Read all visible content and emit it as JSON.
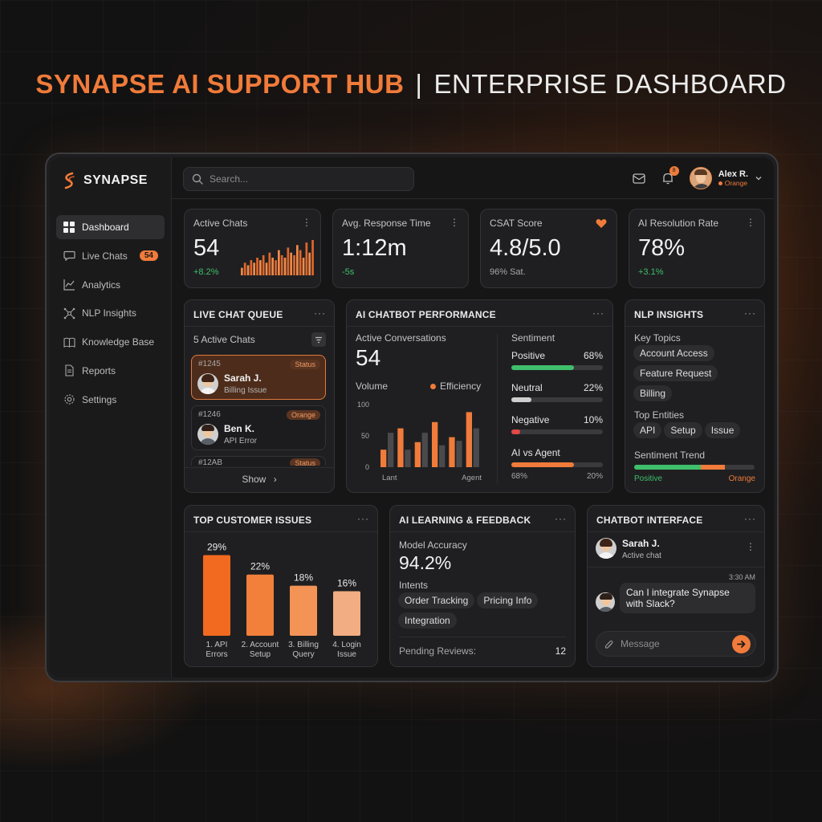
{
  "headline": {
    "brand": "SYNAPSE AI SUPPORT HUB",
    "separator": "|",
    "rest": "ENTERPRISE DASHBOARD"
  },
  "app": {
    "logo_text": "SYNAPSE"
  },
  "sidebar": {
    "items": [
      {
        "label": "Dashboard",
        "icon": "grid-icon",
        "active": true
      },
      {
        "label": "Live Chats",
        "icon": "chat-bubble-icon",
        "badge": "54"
      },
      {
        "label": "Analytics",
        "icon": "line-chart-icon"
      },
      {
        "label": "NLP Insights",
        "icon": "network-icon"
      },
      {
        "label": "Knowledge Base",
        "icon": "book-icon"
      },
      {
        "label": "Reports",
        "icon": "document-icon"
      },
      {
        "label": "Settings",
        "icon": "gear-icon"
      }
    ]
  },
  "topbar": {
    "search_placeholder": "Search...",
    "notification_count": "8",
    "user": {
      "name": "Alex R.",
      "status": "Orange"
    }
  },
  "kpis": [
    {
      "label": "Active Chats",
      "value": "54",
      "sub": "+8.2%",
      "icon": "more-icon"
    },
    {
      "label": "Avg. Response Time",
      "value": "1:12m",
      "sub": "-5s",
      "icon": "more-icon"
    },
    {
      "label": "CSAT Score",
      "value": "4.8/5.0",
      "sub": "96% Sat.",
      "icon": "heart-icon"
    },
    {
      "label": "AI Resolution Rate",
      "value": "78%",
      "sub": "+3.1%",
      "icon": "more-icon"
    }
  ],
  "sparkline": [
    3,
    5,
    4,
    6,
    5,
    7,
    6,
    8,
    5,
    9,
    7,
    6,
    10,
    8,
    7,
    11,
    9,
    8,
    12,
    10,
    7,
    13,
    9,
    14
  ],
  "queue": {
    "title": "LIVE CHAT QUEUE",
    "sub": "5 Active Chats",
    "items": [
      {
        "id": "#1245",
        "badge": "Status",
        "name": "Sarah J.",
        "issue": "Billing Issue",
        "active": true
      },
      {
        "id": "#1246",
        "badge": "Orange",
        "name": "Ben K.",
        "issue": "API Error"
      },
      {
        "id": "#12AB",
        "badge": "Status"
      }
    ],
    "show_label": "Show"
  },
  "performance": {
    "title": "AI CHATBOT PERFORMANCE",
    "active_label": "Active Conversations",
    "active_value": "54",
    "volume_label": "Volume",
    "efficiency_label": "Efficiency",
    "sentiment_title": "Sentiment",
    "sentiments": [
      {
        "label": "Positive",
        "value": "68%",
        "pct": 0.68,
        "color": "#3fbf6b"
      },
      {
        "label": "Neutral",
        "value": "22%",
        "pct": 0.22,
        "color": "#cfcfcf"
      },
      {
        "label": "Negative",
        "value": "10%",
        "pct": 0.1,
        "color": "#e04848"
      }
    ],
    "ai_vs_agent_label": "AI vs Agent",
    "ai_vs_agent_pct": 0.68,
    "ai_vs_agent_left": "68%",
    "ai_vs_agent_right": "20%"
  },
  "nlp": {
    "title": "NLP INSIGHTS",
    "key_topics_label": "Key Topics",
    "key_topics": [
      "Account Access",
      "Feature Request",
      "Billing"
    ],
    "entities_label": "Top Entities",
    "entities": [
      "API",
      "Setup",
      "Issue"
    ],
    "trend_label": "Sentiment Trend",
    "trend_left": "Positive",
    "trend_right": "Orange"
  },
  "issues": {
    "title": "TOP CUSTOMER ISSUES"
  },
  "learning": {
    "title": "AI LEARNING & FEEDBACK",
    "accuracy_label": "Model Accuracy",
    "accuracy_value": "94.2%",
    "intents_label": "Intents",
    "intents": [
      "Order Tracking",
      "Pricing Info",
      "Integration"
    ],
    "pending_label": "Pending Reviews:",
    "pending_value": "12"
  },
  "chatbot": {
    "title": "CHATBOT INTERFACE",
    "contact_name": "Sarah J.",
    "contact_status": "Active chat",
    "time": "3:30 AM",
    "message": "Can I integrate Synapse with Slack?",
    "input_placeholder": "Message"
  },
  "chart_data": [
    {
      "type": "bar",
      "title": "Volume / Efficiency",
      "categories": [
        "1",
        "2",
        "3",
        "4",
        "5",
        "6"
      ],
      "x_tick_labels": [
        "Lant",
        "Agent"
      ],
      "series": [
        {
          "name": "Volume",
          "values": [
            28,
            62,
            40,
            72,
            48,
            88
          ],
          "color": "#f07b3a"
        },
        {
          "name": "Efficiency",
          "values": [
            55,
            28,
            55,
            35,
            42,
            62
          ],
          "color": "#4a4a4d"
        }
      ],
      "y_ticks": [
        "0",
        "50",
        "100"
      ],
      "ylim": [
        0,
        100
      ]
    },
    {
      "type": "bar",
      "title": "TOP CUSTOMER ISSUES",
      "categories": [
        "1. API Errors",
        "2. Account Setup",
        "3. Billing Query",
        "4. Login Issue"
      ],
      "values": [
        29,
        22,
        18,
        16
      ],
      "labels": [
        "29%",
        "22%",
        "18%",
        "16%"
      ],
      "ylim": [
        0,
        30
      ]
    }
  ],
  "colors": {
    "accent": "#f07b3a",
    "positive": "#3fbf6b",
    "negative": "#e04848"
  }
}
